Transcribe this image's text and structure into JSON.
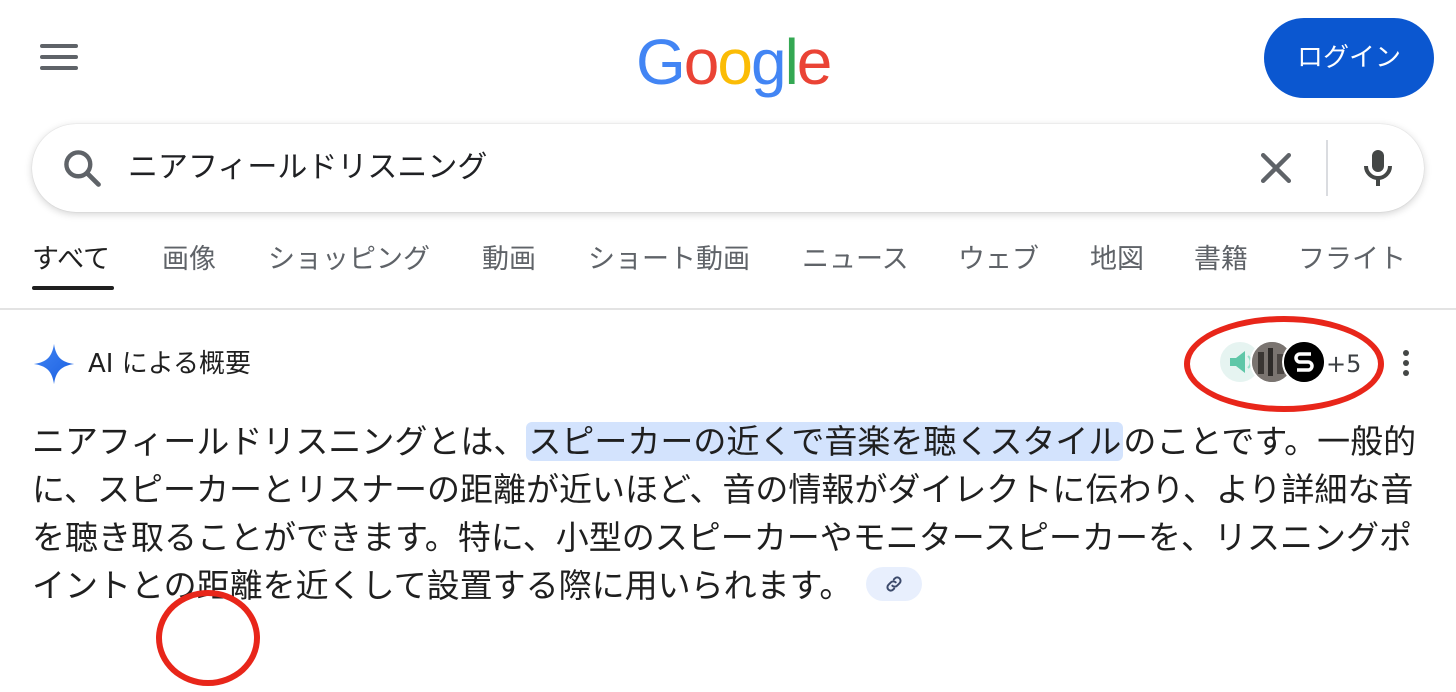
{
  "header": {
    "menu_icon": "hamburger-menu-icon",
    "logo_letters": [
      {
        "char": "G",
        "color": "#4285F4"
      },
      {
        "char": "o",
        "color": "#EA4335"
      },
      {
        "char": "o",
        "color": "#FBBC05"
      },
      {
        "char": "g",
        "color": "#4285F4"
      },
      {
        "char": "l",
        "color": "#34A853"
      },
      {
        "char": "e",
        "color": "#EA4335"
      }
    ],
    "login_label": "ログイン"
  },
  "search": {
    "query": "ニアフィールドリスニング",
    "search_icon": "search-icon",
    "clear_icon": "close-icon",
    "mic_icon": "microphone-icon"
  },
  "tabs": [
    {
      "label": "すべて",
      "active": true
    },
    {
      "label": "画像"
    },
    {
      "label": "ショッピング"
    },
    {
      "label": "動画"
    },
    {
      "label": "ショート動画"
    },
    {
      "label": "ニュース"
    },
    {
      "label": "ウェブ"
    },
    {
      "label": "地図"
    },
    {
      "label": "書籍"
    },
    {
      "label": "フライト"
    }
  ],
  "ai_overview": {
    "title": "AI による概要",
    "sources_more": "+5",
    "text_before": "ニアフィールドリスニングとは、",
    "text_highlight": "スピーカーの近くで音楽を聴くスタイル",
    "text_after": "のことです。一般的に、スピーカーとリスナーの距離が近いほど、音の情報がダイレクトに伝わり、より詳細な音を聴き取ることができます。特に、小型のスピーカーやモニタースピーカーを、リスニングポイントとの距離を近くして設置する際に用いられます。",
    "link_icon": "link-icon"
  },
  "colors": {
    "accent_blue": "#0b57d0",
    "highlight": "#d3e3fd",
    "annotation_red": "#e8261a"
  }
}
